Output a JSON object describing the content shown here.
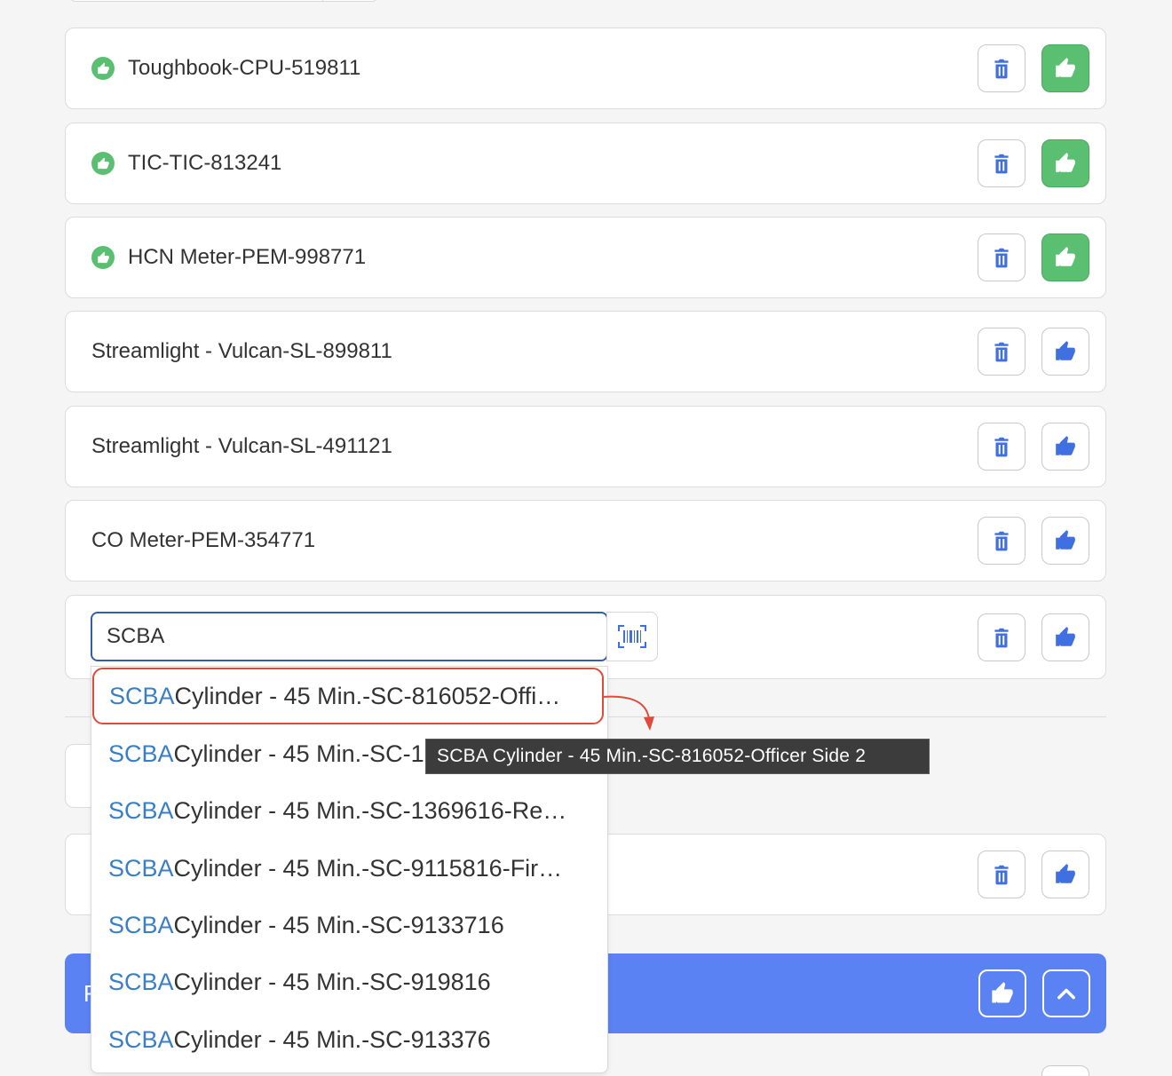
{
  "equipment_items": [
    {
      "name": "Toughbook-CPU-519811",
      "checked": true
    },
    {
      "name": "TIC-TIC-813241",
      "checked": true
    },
    {
      "name": "HCN Meter-PEM-998771",
      "checked": true
    },
    {
      "name": "Streamlight - Vulcan-SL-899811",
      "checked": false
    },
    {
      "name": "Streamlight - Vulcan-SL-491121",
      "checked": false
    },
    {
      "name": "CO Meter-PEM-354771",
      "checked": false
    }
  ],
  "search": {
    "value": "SCBA"
  },
  "icons": {
    "delete": "trash-icon",
    "approve": "thumbs-up-icon",
    "barcode": "barcode-scan-icon",
    "collapse": "chevron-up-icon"
  },
  "dropdown": {
    "match_text": "SCBA",
    "options": [
      " Cylinder - 45 Min.-SC-816052-Offi…",
      " Cylinder - 45 Min.-SC-1",
      " Cylinder - 45 Min.-SC-1369616-Re…",
      " Cylinder - 45 Min.-SC-9115816-Fir…",
      " Cylinder - 45 Min.-SC-9133716",
      " Cylinder - 45 Min.-SC-919816",
      " Cylinder - 45 Min.-SC-913376"
    ]
  },
  "tooltip": {
    "text": "SCBA Cylinder - 45 Min.-SC-816052-Officer Side 2"
  },
  "section_bar": {
    "letter": "F"
  },
  "colors": {
    "success_green": "#5bbf72",
    "primary_blue": "#5a82f2",
    "icon_blue": "#3f6fe0",
    "match_blue": "#3a7fc6",
    "highlight_red": "#e04a3a"
  }
}
